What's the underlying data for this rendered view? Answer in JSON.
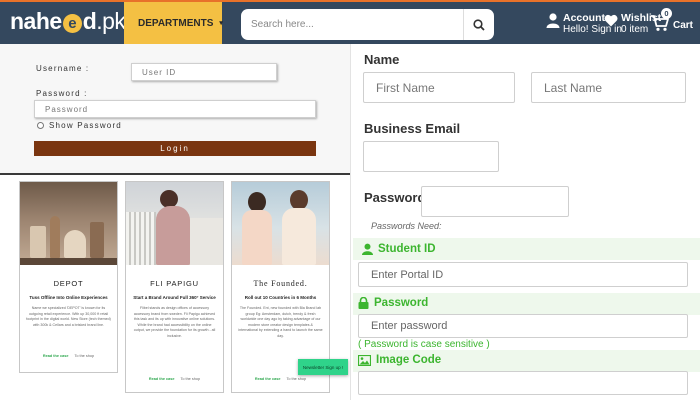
{
  "header": {
    "logo": {
      "prefix": "nahe",
      "mid": "e",
      "suffix": "d",
      "tld": ".pk"
    },
    "departments_label": "DEPARTMENTS",
    "search": {
      "placeholder": "Search here..."
    },
    "account": {
      "title": "Account",
      "subtitle": "Hello! Sign in"
    },
    "wishlist": {
      "title": "Wishlist",
      "subtitle": "0 item"
    },
    "cart": {
      "label": "Cart",
      "count": "0"
    }
  },
  "login": {
    "username_label": "Username :",
    "username_placeholder": "User ID",
    "password_label": "Password :",
    "password_placeholder": "Password",
    "show_password_label": "Show Password",
    "login_button": "Login"
  },
  "cards": [
    {
      "title": "DEPOT",
      "subtitle": "Tuss Offline Into Online Experiences",
      "body": "Name we specialized 'DEPOT' is known for its outgoing retail experience. With up 30,000 ft retail footprint in the digital world. New Store (tech themed) with 300k & Cellars and a brisked brand line.",
      "read_link": "Read the case",
      "shop_link": "To the shop"
    },
    {
      "title": "FLI PAPIGU",
      "subtitle": "Start a Brand Around Full 360° Service",
      "body": "Flibel stands as design offices of accessory accessory brand from sweden. Fli Papigu achieved this task and its up with innovative online solutions. While the brand had accessibility on the online output, we provide the foundation for its growth - all inclusive.",
      "read_link": "Read the case",
      "shop_link": "To the shop"
    },
    {
      "title": "The Founded.",
      "subtitle": "Roll out 10 Countries in 6 Months",
      "body": "The Founded. Ent, new founded with Bla Brand lab group Eg: Amsterdam, dutch, trendy & fresh worldwide one day ago by taking advantage of our modern store creator design templates & international by extending a hand to launch the same day.",
      "read_link": "Read the case",
      "shop_link": "To the shop",
      "newsletter_button": "Newsletter Sign up !"
    }
  ],
  "register": {
    "name_label": "Name",
    "first_name_placeholder": "First Name",
    "last_name_placeholder": "Last Name",
    "business_email_label": "Business Email",
    "password_label": "Password",
    "password_hint": "Passwords Need:"
  },
  "portal": {
    "student_id_label": "Student ID",
    "student_id_placeholder": "Enter Portal ID",
    "password_label": "Password",
    "password_placeholder": "Enter password",
    "case_note": "( Password is case sensitive )",
    "image_code_label": "Image Code"
  },
  "colors": {
    "nav_bg": "#34485e",
    "nav_accent_top": "#e8722a",
    "departments_bg": "#f4c043",
    "login_button_bg": "#7a3510",
    "portal_green": "#3cb52f",
    "newsletter_green": "#2fd38a"
  },
  "icons": [
    "hamburger-icon",
    "search-icon",
    "user-icon",
    "heart-icon",
    "cart-icon",
    "lock-icon",
    "image-icon"
  ]
}
